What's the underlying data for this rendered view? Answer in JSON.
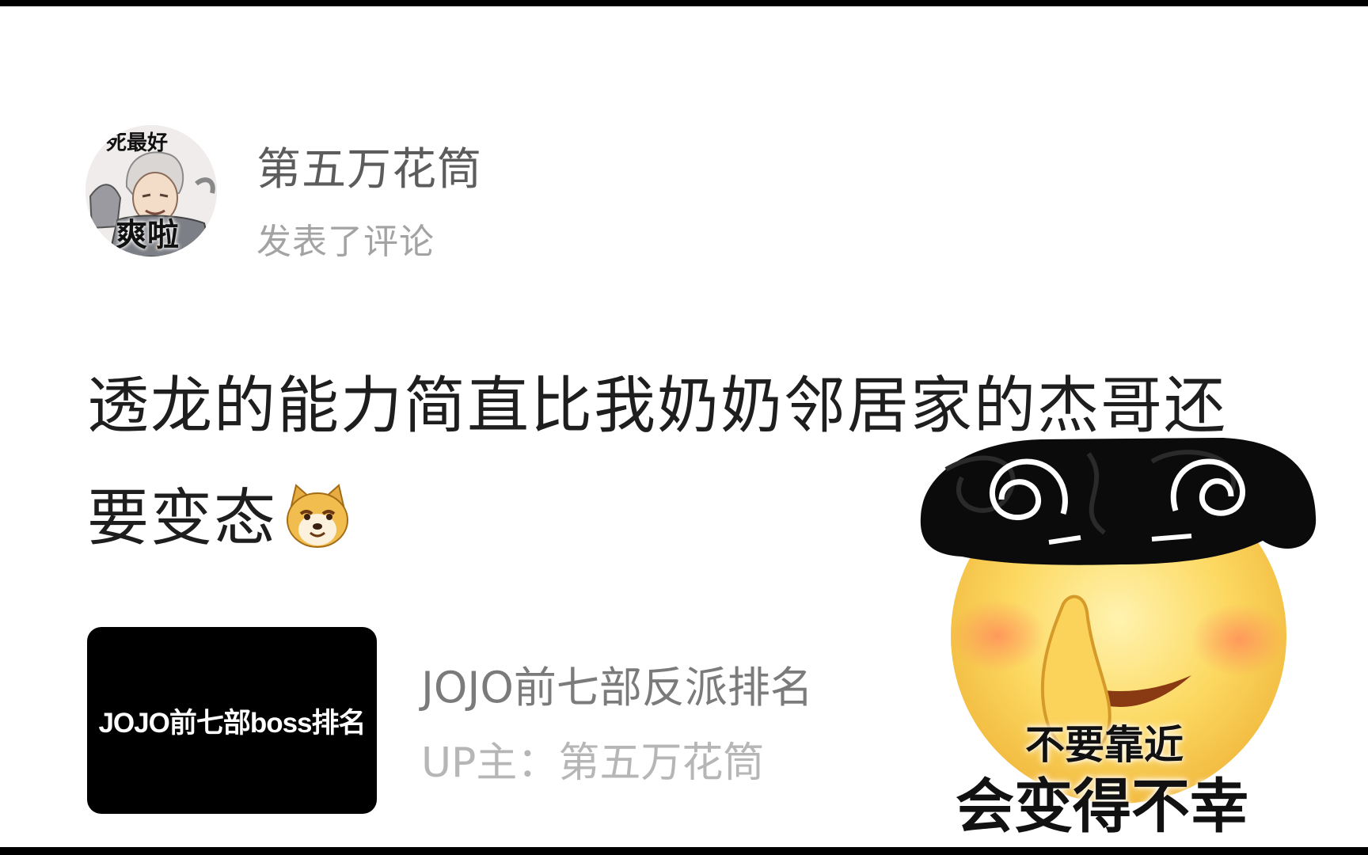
{
  "post": {
    "author": {
      "name": "第五万花筒",
      "avatar_caption_top": "死最好",
      "avatar_caption_bottom": "爽啦"
    },
    "action": "发表了评论",
    "comment": {
      "line1": "透龙的能力简直比我奶奶邻居家的杰哥还",
      "line2": "要变态",
      "emoji": "doge-emoji"
    }
  },
  "video_card": {
    "thumbnail_text": "JOJO前七部boss排名",
    "title": "JOJO前七部反派排名",
    "up_label": "UP主：第五万花筒"
  },
  "sticker": {
    "line1": "不要靠近",
    "line2": "会变得不幸"
  },
  "colors": {
    "frame": "#000000",
    "background": "#ffffff",
    "name": "#5c5c5c",
    "meta": "#a3a3a3",
    "comment": "#1e1e1e"
  }
}
